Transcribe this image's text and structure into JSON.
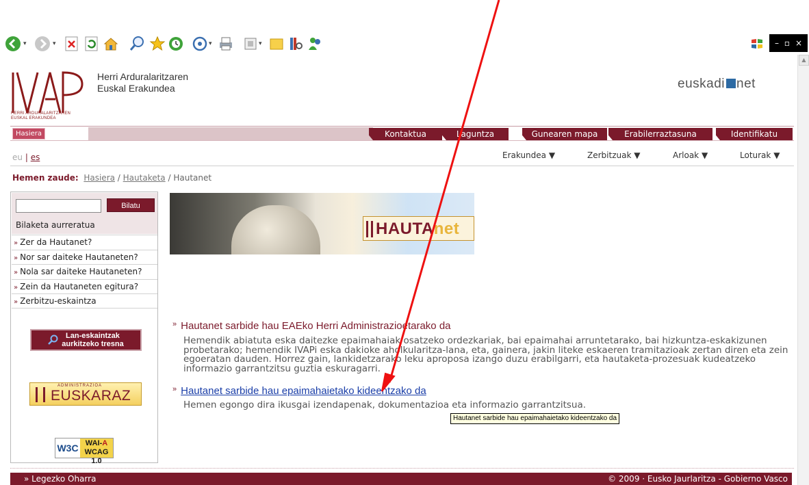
{
  "browser": {
    "toolbar_icons": [
      "back-icon",
      "forward-icon",
      "stop-icon",
      "refresh-icon",
      "home-icon",
      "search-icon",
      "favorites-icon",
      "history-icon",
      "mail-icon",
      "print-icon",
      "edit-icon",
      "folder-icon",
      "research-icon",
      "messenger-icon"
    ],
    "window_controls": {
      "minimize": "–",
      "maximize": "▫",
      "close": "×"
    }
  },
  "header": {
    "logo_text": "IVAP",
    "logo_subtitle_1": "HERRI ARDURALARITZAREN",
    "logo_subtitle_2": "EUSKAL ERAKUNDEA",
    "org_name_1": "Herri Arduralaritzaren",
    "org_name_2": "Euskal Erakundea",
    "partner_logo_left": "euskadi",
    "partner_logo_right": "net"
  },
  "nav": {
    "home": "Hasiera",
    "tabs": [
      "Kontaktua",
      "Laguntza",
      "Gunearen mapa",
      "Erabilerraztasuna",
      "Identifikatu"
    ]
  },
  "lang": {
    "current": "eu",
    "other": "es"
  },
  "subnav": [
    "Erakundea",
    "Zerbitzuak",
    "Arloak",
    "Loturak"
  ],
  "breadcrumb": {
    "label": "Hemen zaude:",
    "items": [
      "Hasiera",
      "Hautaketa"
    ],
    "current": "Hautanet",
    "separator": " / "
  },
  "sidebar": {
    "search_placeholder": "",
    "search_button": "Bilatu",
    "advanced_search": "Bilaketa aurreratua",
    "items": [
      "Zer da Hautanet?",
      "Nor sar daiteke Hautaneten?",
      "Nola sar daiteke Hautaneten?",
      "Zein da Hautaneten egitura?",
      "Zerbitzu-eskaintza"
    ],
    "lan_button_1": "Lan-eskaintzak",
    "lan_button_2": "aurkitzeko tresna",
    "euskaraz_tag": "ADMINISTRAZIOA",
    "euskaraz_word": "EUSKARAZ",
    "wai_left": "W3C",
    "wai_top_1": "WAI-",
    "wai_top_2": "A",
    "wai_bottom": "WCAG 1.0"
  },
  "banner": {
    "logo_main": "HAUTA",
    "logo_accent": "net"
  },
  "content": {
    "section1_title": "Hautanet sarbide hau EAEko Herri Administrazioetarako da",
    "section1_body": "Hemendik abiatuta eska daitezke epaimahaiak osatzeko ordezkariak, bai epaimahai arruntetarako, bai hizkuntza-eskakizunen probetarako; hemendik IVAPi eska dakioke aholkularitza-lana, eta, gainera, jakin liteke eskaeren tramitazioak zertan diren eta zein egoeratan dauden. Horrez gain, lankidetzarako leku aproposa izango duzu erabilgarri, eta hautaketa-prozesuak kudeatzeko informazio garrantzitsu guztia eskuragarri.",
    "section2_title": "Hautanet sarbide hau epaimahaietako kideentzako da",
    "section2_body": "Hemen egongo dira ikusgai izendapenak, dokumentazioa eta informazio garrantzitsua.",
    "tooltip": "Hautanet sarbide hau epaimahaietako kideentzako da"
  },
  "footer": {
    "left": "Legezko Oharra",
    "right": "© 2009 · Eusko Jaurlaritza - Gobierno Vasco"
  },
  "colors": {
    "brand": "#7b1a2b",
    "link": "#1a3ea8",
    "annotation": "#ee1111"
  }
}
